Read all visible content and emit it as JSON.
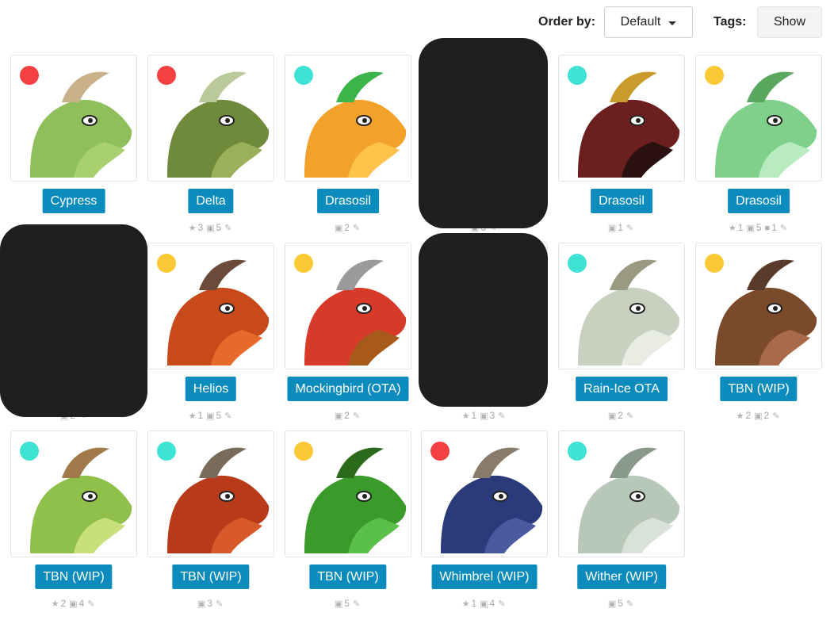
{
  "toolbar": {
    "order_label": "Order by:",
    "order_value": "Default",
    "tags_label": "Tags:",
    "tags_button": "Show"
  },
  "colors": {
    "accent": "#0b8cbd",
    "status_red": "#f44040",
    "status_teal": "#3ee3d3",
    "status_yellow": "#fbc935"
  },
  "cards": [
    {
      "name": "Cypress",
      "status": "red",
      "stats": {
        "favorites": "",
        "images": "",
        "comments": ""
      }
    },
    {
      "name": "Delta",
      "status": "red",
      "stats": {
        "favorites": "3",
        "images": "5",
        "comments": ""
      }
    },
    {
      "name": "Drasosil",
      "status": "teal",
      "stats": {
        "favorites": "",
        "images": "2",
        "comments": ""
      }
    },
    {
      "name": "",
      "status": "",
      "stats": {
        "favorites": "",
        "images": "6",
        "comments": ""
      }
    },
    {
      "name": "Drasosil",
      "status": "teal",
      "stats": {
        "favorites": "",
        "images": "1",
        "comments": ""
      }
    },
    {
      "name": "Drasosil",
      "status": "yellow",
      "stats": {
        "favorites": "1",
        "images": "5",
        "comments": "1"
      }
    },
    {
      "name": "",
      "status": "",
      "stats": {
        "favorites": "",
        "images": "2",
        "comments": ""
      }
    },
    {
      "name": "Helios",
      "status": "yellow",
      "stats": {
        "favorites": "1",
        "images": "5",
        "comments": ""
      }
    },
    {
      "name": "Mockingbird (OTA)",
      "status": "yellow",
      "stats": {
        "favorites": "",
        "images": "2",
        "comments": ""
      }
    },
    {
      "name": "",
      "status": "",
      "stats": {
        "favorites": "1",
        "images": "3",
        "comments": ""
      }
    },
    {
      "name": "Rain-Ice OTA",
      "status": "teal",
      "stats": {
        "favorites": "",
        "images": "2",
        "comments": ""
      }
    },
    {
      "name": "TBN (WIP)",
      "status": "yellow",
      "stats": {
        "favorites": "2",
        "images": "2",
        "comments": ""
      }
    },
    {
      "name": "TBN (WIP)",
      "status": "teal",
      "stats": {
        "favorites": "2",
        "images": "4",
        "comments": ""
      }
    },
    {
      "name": "TBN (WIP)",
      "status": "teal",
      "stats": {
        "favorites": "",
        "images": "3",
        "comments": ""
      }
    },
    {
      "name": "TBN (WIP)",
      "status": "yellow",
      "stats": {
        "favorites": "",
        "images": "5",
        "comments": ""
      }
    },
    {
      "name": "Whimbrel (WIP)",
      "status": "red",
      "stats": {
        "favorites": "1",
        "images": "4",
        "comments": ""
      }
    },
    {
      "name": "Wither (WIP)",
      "status": "teal",
      "stats": {
        "favorites": "",
        "images": "5",
        "comments": ""
      }
    }
  ]
}
